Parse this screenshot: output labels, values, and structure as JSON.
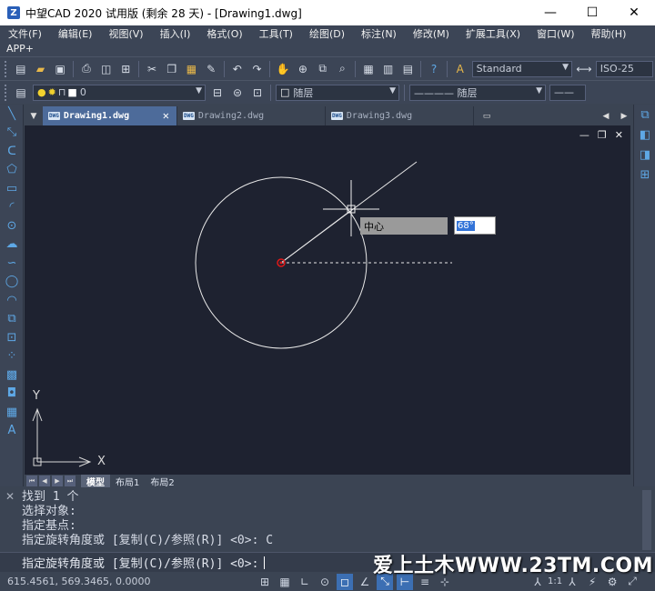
{
  "window": {
    "title": "中望CAD 2020 试用版 (剩余 28 天) - [Drawing1.dwg]",
    "app_icon": "zwcad-logo-icon",
    "minimize": "—",
    "maximize": "☐",
    "close": "✕"
  },
  "menu": {
    "row1": [
      "文件(F)",
      "编辑(E)",
      "视图(V)",
      "插入(I)",
      "格式(O)",
      "工具(T)",
      "绘图(D)",
      "标注(N)",
      "修改(M)",
      "扩展工具(X)",
      "窗口(W)",
      "帮助(H)"
    ],
    "row2": [
      "APP+"
    ]
  },
  "toolbar": {
    "text_style": "Standard",
    "dim_style": "ISO-25",
    "layer_value": "0",
    "color_value": "随层",
    "linetype_value": "———— 随层"
  },
  "document_tabs": [
    {
      "label": "Drawing1.dwg",
      "active": true,
      "badge": "DWG"
    },
    {
      "label": "Drawing2.dwg",
      "active": false,
      "badge": "DWG"
    },
    {
      "label": "Drawing3.dwg",
      "active": false,
      "badge": "DWG"
    }
  ],
  "canvas": {
    "dynamic_prompt_label": "中心",
    "dynamic_input_value": "68°",
    "ucs_x": "X",
    "ucs_y": "Y",
    "controls": {
      "minimize": "—",
      "restore": "❐",
      "close": "✕"
    }
  },
  "layout_tabs": [
    "模型",
    "布局1",
    "布局2"
  ],
  "command": {
    "history": [
      "找到 1 个",
      "选择对象:",
      "指定基点:",
      "指定旋转角度或 [复制(C)/参照(R)] <0>: C"
    ],
    "current_prompt": "指定旋转角度或 [复制(C)/参照(R)] <0>:"
  },
  "status": {
    "coordinates": "615.4561, 569.3465, 0.0000",
    "scale": "1:1"
  },
  "watermark": "爱上土木WWW.23TM.COM",
  "colors": {
    "canvas_bg": "#1e2230",
    "ui_bg": "#3b4453",
    "accent": "#3c6fb3",
    "center_marker": "#e01818"
  }
}
